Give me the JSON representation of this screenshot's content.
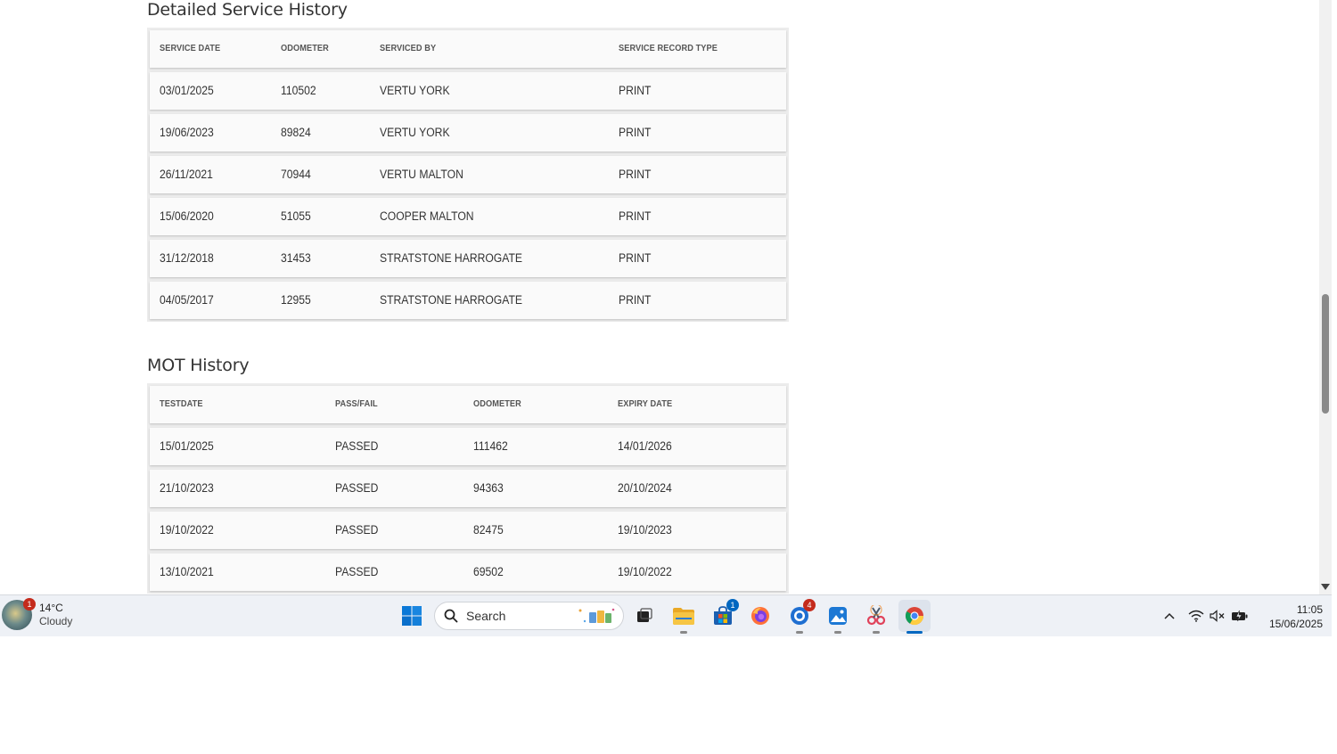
{
  "service": {
    "title": "Detailed Service History",
    "headers": [
      "SERVICE DATE",
      "ODOMETER",
      "SERVICED BY",
      "SERVICE RECORD TYPE"
    ],
    "rows": [
      [
        "03/01/2025",
        "110502",
        "VERTU YORK",
        "PRINT"
      ],
      [
        "19/06/2023",
        "89824",
        "VERTU YORK",
        "PRINT"
      ],
      [
        "26/11/2021",
        "70944",
        "VERTU MALTON",
        "PRINT"
      ],
      [
        "15/06/2020",
        "51055",
        "COOPER MALTON",
        "PRINT"
      ],
      [
        "31/12/2018",
        "31453",
        "STRATSTONE HARROGATE",
        "PRINT"
      ],
      [
        "04/05/2017",
        "12955",
        "STRATSTONE HARROGATE",
        "PRINT"
      ]
    ]
  },
  "mot": {
    "title": "MOT History",
    "headers": [
      "TESTDATE",
      "PASS/FAIL",
      "ODOMETER",
      "EXPIRY DATE"
    ],
    "rows": [
      [
        "15/01/2025",
        "PASSED",
        "111462",
        "14/01/2026"
      ],
      [
        "21/10/2023",
        "PASSED",
        "94363",
        "20/10/2024"
      ],
      [
        "19/10/2022",
        "PASSED",
        "82475",
        "19/10/2023"
      ],
      [
        "13/10/2021",
        "PASSED",
        "69502",
        "19/10/2022"
      ]
    ]
  },
  "taskbar": {
    "weather_temp": "14°C",
    "weather_condition": "Cloudy",
    "weather_badge": "1",
    "search_label": "Search",
    "store_badge": "1",
    "app_badge": "4",
    "time": "11:05",
    "date": "15/06/2025",
    "accent_color": "#0067c0",
    "badge_color": "#c42b1c"
  }
}
